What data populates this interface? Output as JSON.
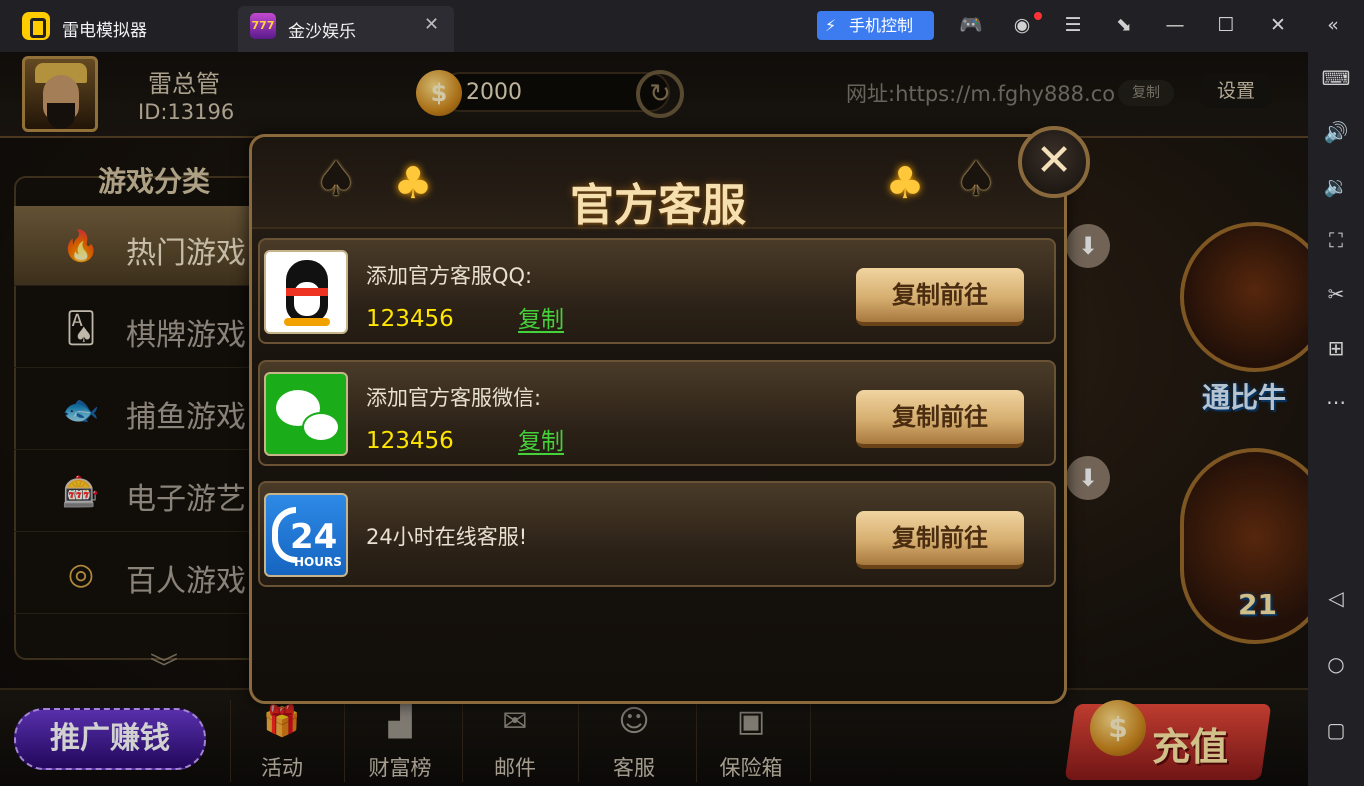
{
  "emulator": {
    "app_name": "雷电模拟器",
    "tab_title": "金沙娱乐",
    "tab_icon_text": "777",
    "tab_close": "✕",
    "phone_control": "手机控制",
    "icons": [
      "gamepad-icon",
      "account-icon",
      "menu-icon",
      "minimize-to-tray-icon",
      "minimize-icon",
      "maximize-icon",
      "close-icon",
      "collapse-sidebar-icon"
    ],
    "sidebar_icons": [
      "keyboard-icon",
      "volume-up-icon",
      "volume-down-icon",
      "screenshot-icon",
      "scissors-icon",
      "add-app-icon",
      "more-icon",
      "back-icon",
      "home-icon",
      "recent-apps-icon"
    ]
  },
  "player": {
    "name": "雷总管",
    "id": "ID:13196",
    "coins": "2000"
  },
  "top": {
    "url": "网址:https://m.fghy888.co",
    "copy": "复制",
    "settings": "设置"
  },
  "categories": {
    "header": "游戏分类",
    "items": [
      {
        "label": "热门游戏",
        "icon": "hot-fire-icon",
        "active": true
      },
      {
        "label": "棋牌游戏",
        "icon": "cards-icon",
        "active": false
      },
      {
        "label": "捕鱼游戏",
        "icon": "fish-icon",
        "active": false
      },
      {
        "label": "电子游艺",
        "icon": "slot-machine-icon",
        "active": false
      },
      {
        "label": "百人游戏",
        "icon": "roulette-icon",
        "active": false
      }
    ]
  },
  "games_right": {
    "label1": "通比牛",
    "label2": "21"
  },
  "bottom": {
    "promo": "推广赚钱",
    "nav": [
      {
        "label": "活动",
        "icon": "gift-icon"
      },
      {
        "label": "财富榜",
        "icon": "podium-icon"
      },
      {
        "label": "邮件",
        "icon": "mail-icon"
      },
      {
        "label": "客服",
        "icon": "agent-icon"
      },
      {
        "label": "保险箱",
        "icon": "safe-icon"
      }
    ],
    "recharge": "充值"
  },
  "modal": {
    "title": "官方客服",
    "close": "✕",
    "rows": [
      {
        "title": "添加官方客服QQ:",
        "number": "123456",
        "copy": "复制",
        "button": "复制前往",
        "icon": "qq-icon"
      },
      {
        "title": "添加官方客服微信:",
        "number": "123456",
        "copy": "复制",
        "button": "复制前往",
        "icon": "wechat-icon"
      },
      {
        "title": "24小时在线客服!",
        "button": "复制前往",
        "icon": "hours-24-icon",
        "icon_number": "24",
        "icon_text": "HOURS"
      }
    ]
  },
  "colors": {
    "accent_gold": "#d6ae70",
    "number_yellow": "#ffe500",
    "copy_green": "#44d13a",
    "phone_control_blue": "#3c7cf0"
  }
}
